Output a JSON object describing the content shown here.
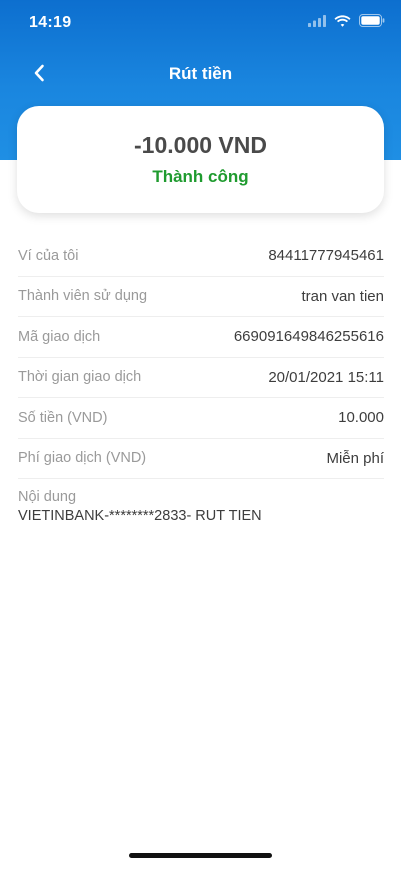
{
  "status_bar": {
    "time": "14:19",
    "icons": [
      "signal-icon",
      "wifi-icon",
      "battery-icon"
    ]
  },
  "nav": {
    "title": "Rút tiền",
    "back_icon": "chevron-left-icon"
  },
  "summary": {
    "amount": "-10.000 VND",
    "status": "Thành công"
  },
  "details": {
    "rows": [
      {
        "label": "Ví của tôi",
        "value": "84411777945461"
      },
      {
        "label": "Thành viên sử dụng",
        "value": "tran van tien"
      },
      {
        "label": "Mã giao dịch",
        "value": "669091649846255616"
      },
      {
        "label": "Thời gian giao dịch",
        "value": "20/01/2021 15:11"
      },
      {
        "label": "Số tiền (VND)",
        "value": "10.000"
      },
      {
        "label": "Phí giao dịch (VND)",
        "value": "Miễn phí"
      }
    ],
    "content": {
      "label": "Nội dung",
      "value": "VIETINBANK-********2833- RUT TIEN"
    }
  },
  "colors": {
    "header_top": "#0d6fcf",
    "header_bottom": "#1f8fe4",
    "success": "#1f9b2f",
    "label": "#9a9a9a",
    "value": "#3d3d3d"
  }
}
